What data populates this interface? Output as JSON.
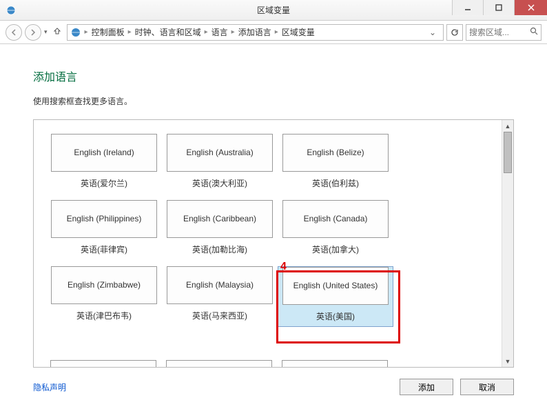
{
  "window": {
    "title": "区域变量"
  },
  "breadcrumb": {
    "items": [
      "控制面板",
      "时钟、语言和区域",
      "语言",
      "添加语言",
      "区域变量"
    ]
  },
  "search": {
    "placeholder": "搜索区域..."
  },
  "page": {
    "title": "添加语言",
    "subtitle": "使用搜索框查找更多语言。"
  },
  "languages": [
    {
      "en": "English (Ireland)",
      "zh": "英语(爱尔兰)",
      "selected": false
    },
    {
      "en": "English (Australia)",
      "zh": "英语(澳大利亚)",
      "selected": false
    },
    {
      "en": "English (Belize)",
      "zh": "英语(伯利兹)",
      "selected": false
    },
    {
      "en": "English (Philippines)",
      "zh": "英语(菲律宾)",
      "selected": false
    },
    {
      "en": "English (Caribbean)",
      "zh": "英语(加勒比海)",
      "selected": false
    },
    {
      "en": "English (Canada)",
      "zh": "英语(加拿大)",
      "selected": false
    },
    {
      "en": "English (Zimbabwe)",
      "zh": "英语(津巴布韦)",
      "selected": false
    },
    {
      "en": "English (Malaysia)",
      "zh": "英语(马来西亚)",
      "selected": false
    },
    {
      "en": "English (United States)",
      "zh": "英语(美国)",
      "selected": true
    }
  ],
  "annotation": {
    "label": "4"
  },
  "footer": {
    "privacy": "隐私声明",
    "add": "添加",
    "cancel": "取消"
  }
}
